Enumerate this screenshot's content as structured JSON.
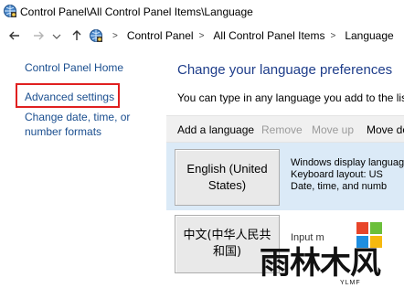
{
  "window": {
    "title": "Control Panel\\All Control Panel Items\\Language",
    "icon": "control-panel-icon"
  },
  "nav": {
    "back_icon": "arrow-left-icon",
    "forward_icon": "arrow-right-icon",
    "recent_icon": "chevron-down-icon",
    "up_icon": "arrow-up-icon"
  },
  "breadcrumb": {
    "items": [
      "Control Panel",
      "All Control Panel Items",
      "Language"
    ],
    "separator": ">"
  },
  "sidebar": {
    "home": "Control Panel Home",
    "advanced": "Advanced settings",
    "change": "Change date, time, or number formats"
  },
  "main": {
    "heading": "Change your language preferences",
    "description": "You can type in any language you add to the list. Wi"
  },
  "toolbar": {
    "add": "Add a language",
    "remove": "Remove",
    "move_up": "Move up",
    "move_down": "Move do"
  },
  "languages": [
    {
      "name": "English (United States)",
      "details": [
        "Windows display language",
        "Keyboard layout: US",
        "Date, time, and numb"
      ],
      "selected": true
    },
    {
      "name": "中文(中华人民共和国)",
      "details": [
        "Input m"
      ],
      "selected": false
    }
  ],
  "watermark": {
    "text": "雨林木风",
    "sub": "YLMF"
  },
  "colors": {
    "link": "#1a4e8f",
    "heading": "#1e3d8a",
    "highlight": "#e02020",
    "selected_row": "#dbeaf7",
    "toolbar_bg": "#f0f0f0"
  }
}
